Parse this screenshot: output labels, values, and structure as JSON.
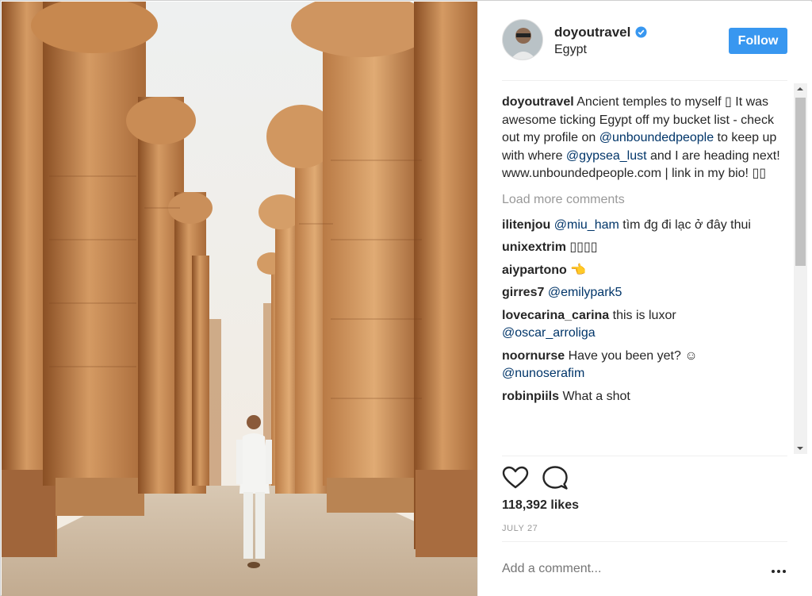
{
  "post": {
    "image_alt": "Man in white walking between giant columns of an ancient Egyptian temple",
    "colors": {
      "accent": "#3897f0",
      "mention": "#003569",
      "muted": "#999999",
      "text": "#262626"
    }
  },
  "header": {
    "username": "doyoutravel",
    "verified_icon": "verified-badge-icon",
    "location": "Egypt",
    "follow_label": "Follow"
  },
  "caption": {
    "user": "doyoutravel",
    "text_before_1": "Ancient temples to myself ▯ It was awesome ticking Egypt off my bucket list - check out my profile on ",
    "mention_1": "@unboundedpeople",
    "text_before_2": " to keep up with where ",
    "mention_2": "@gypsea_lust",
    "text_after": " and I are heading next! www.unboundedpeople.com | link in my bio! ▯▯"
  },
  "load_more": "Load more comments",
  "comments": [
    {
      "user": "ilitenjou",
      "mention": "@miu_ham",
      "text": " tìm đg đi lạc ở đây thui"
    },
    {
      "user": "unixextrim",
      "mention": "",
      "text": " ▯▯▯▯"
    },
    {
      "user": "aiypartono",
      "mention": "",
      "text": " 👈"
    },
    {
      "user": "girres7",
      "mention": "@emilypark5",
      "text": ""
    },
    {
      "user": "lovecarina_carina",
      "mention": "",
      "text": " this is luxor",
      "mention_after": "@oscar_arroliga"
    },
    {
      "user": "noornurse",
      "mention": "",
      "text": " Have you been yet? ☺",
      "mention_after": "@nunoserafim"
    },
    {
      "user": "robinpiils",
      "mention": "",
      "text": " What a shot"
    }
  ],
  "actions": {
    "like_icon": "heart-icon",
    "comment_icon": "comment-icon"
  },
  "likes": "118,392 likes",
  "date": "JULY 27",
  "add_comment_placeholder": "Add a comment...",
  "more_icon": "more-options-icon"
}
